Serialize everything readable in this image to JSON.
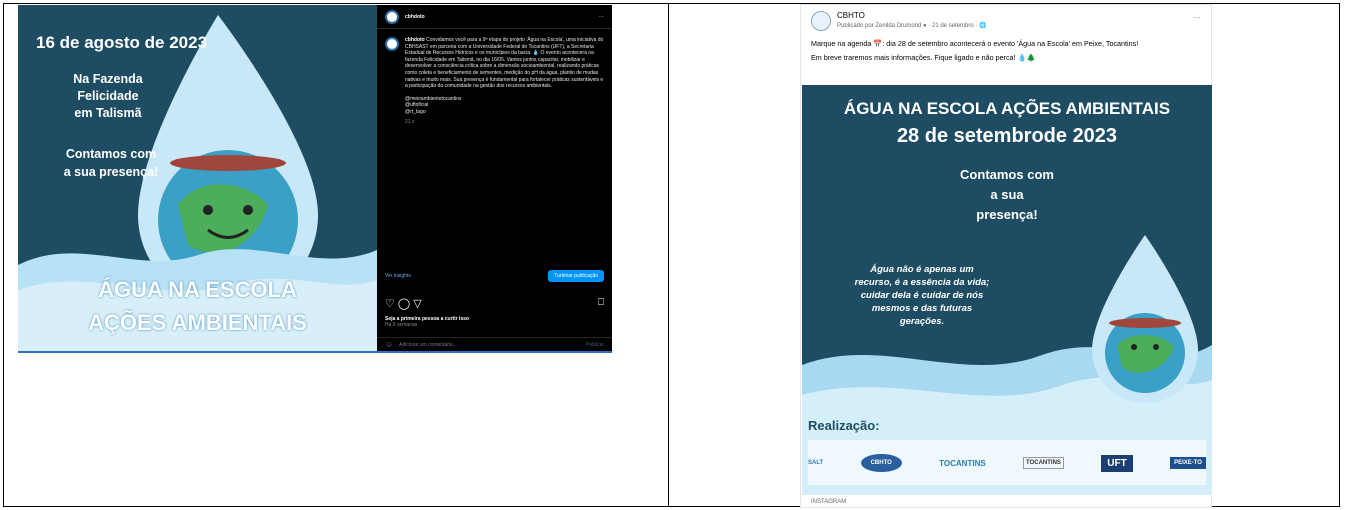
{
  "left_poster": {
    "date": "16 de agosto de 2023",
    "location": "Na Fazenda\nFelicidade\nem Talismã",
    "presence": "Contamos com\na sua presença!",
    "title_line1": "ÁGUA NA ESCOLA",
    "title_line2": "AÇÕES AMBIENTAIS"
  },
  "instagram": {
    "username": "cbhdoto",
    "caption_user": "cbhdoto",
    "caption": "Convidamos você para a 9ª etapa do projeto 'Água na Escola', uma iniciativa do CBHSAST em parceria com a Universidade Federal do Tocantins (UFT), a Secretaria Estadual de Recursos Hídricos e os municípios da bacia. 💧 O evento acontecerá na fazenda Felicidade em Talismã, no dia 16/05. Vamos juntos capacitar, mobilizar e desenvolver a consciência crítica sobre a dimensão socioambiental, realizando práticas como coleta e beneficiamento de sementes, medição do pH da água, plantio de mudas nativas e muito mais. Sua presença é fundamental para fortalecer práticas sustentáveis e a participação da comunidade na gestão dos recursos ambientais.",
    "mentions": [
      "@meioambientetocantins",
      "@uftoficial",
      "@rt_tago"
    ],
    "age": "21 s",
    "see_insights": "Ver insights",
    "boost_button": "Turbinar publicação",
    "likes_text": "Seja a primeira pessoa a curtir isso",
    "likes_sub": "Há 3 semanas",
    "comment_placeholder": "Adicione um comentário...",
    "publish": "Publicar"
  },
  "facebook": {
    "page_name": "CBHTO",
    "meta": "Publicado por Zenilda Drumond ● · 21 de setembro · 🌐",
    "more": "···",
    "text_line1": "Marque na agenda 📅: dia 28 de setembro acontecerá o evento 'Água na Escola' em Peixe, Tocantins!",
    "text_line2": "Em breve traremos mais informações. Fique ligado e não perca! 💧🌲",
    "footer": "INSTAGRAM"
  },
  "right_poster": {
    "title": "ÁGUA NA ESCOLA AÇÕES AMBIENTAIS",
    "date": "28 de setembrode 2023",
    "presence": "Contamos com\na sua\npresença!",
    "quote": "Água não é apenas um\nrecurso, é a essência da vida;\ncuidar dela é cuidar de nós\nmesmos e das futuras\ngerações.",
    "realizacao": "Realização:",
    "logos": [
      "SALT",
      "CBHTO",
      "TOCANTINS",
      "TOCANTINS",
      "UFT",
      "PEIXE-TO"
    ]
  },
  "colors": {
    "poster_bg": "#1e4d63",
    "water": "#9fd3ee",
    "ig_bg": "#000000",
    "ig_button": "#0095f6"
  }
}
